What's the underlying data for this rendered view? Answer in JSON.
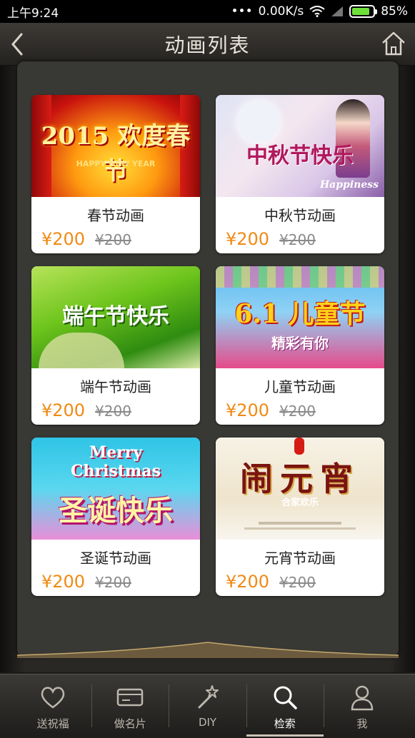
{
  "status_bar": {
    "time": "上午9:24",
    "network_speed": "0.00K/s",
    "battery_percent": "85%",
    "battery_level": 0.85
  },
  "header": {
    "title": "动画列表",
    "back_icon": "chevron-left-icon",
    "home_icon": "home-icon"
  },
  "cards": [
    {
      "name": "春节动画",
      "price": "¥200",
      "old_price": "¥200",
      "image_text": "2015 欢度春节",
      "image_sub": "HAPPY NEW YEAR"
    },
    {
      "name": "中秋节动画",
      "price": "¥200",
      "old_price": "¥200",
      "image_text": "中秋节快乐",
      "image_sub": "Happiness"
    },
    {
      "name": "端午节动画",
      "price": "¥200",
      "old_price": "¥200",
      "image_text": "端午节快乐",
      "image_sub": ""
    },
    {
      "name": "儿童节动画",
      "price": "¥200",
      "old_price": "¥200",
      "image_text": "6.1 儿童节",
      "image_sub": "精彩有你"
    },
    {
      "name": "圣诞节动画",
      "price": "¥200",
      "old_price": "¥200",
      "image_text": "Merry Christmas",
      "image_sub": "圣诞快乐"
    },
    {
      "name": "元宵节动画",
      "price": "¥200",
      "old_price": "¥200",
      "image_text": "闹元宵",
      "image_sub": "合家欢乐"
    }
  ],
  "tabs": [
    {
      "label": "送祝福",
      "icon": "heart-icon",
      "active": false
    },
    {
      "label": "做名片",
      "icon": "card-icon",
      "active": false
    },
    {
      "label": "DIY",
      "icon": "magic-wand-icon",
      "active": false
    },
    {
      "label": "检索",
      "icon": "search-icon",
      "active": true
    },
    {
      "label": "我",
      "icon": "user-icon",
      "active": false
    }
  ]
}
